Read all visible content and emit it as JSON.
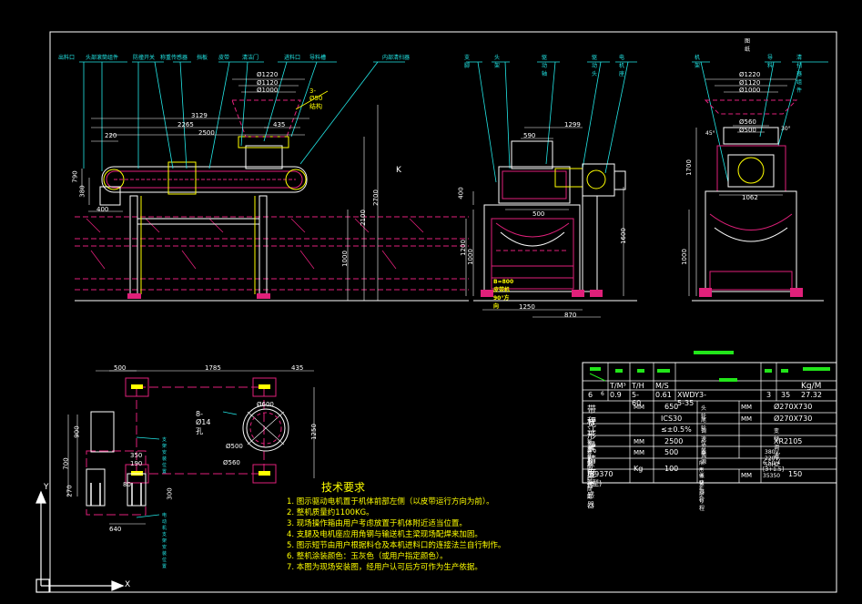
{
  "front_view": {
    "callouts": [
      "出料口",
      "头部滚筒组件",
      "防撞开关",
      "称重传感器",
      "挡板",
      "皮带",
      "清洁门",
      "进料口",
      "导料槽",
      "内部清扫器"
    ],
    "dims": {
      "d1220": "Ø1220",
      "d1120": "Ø1120",
      "d1000": "Ø1000",
      "d3129": "3129",
      "d2265": "2265",
      "d435": "435",
      "d2500": "2500",
      "d220": "220",
      "d790": "790",
      "d380": "380",
      "d400": "400",
      "d2700": "2700",
      "d2100": "2100",
      "d1000v": "1000",
      "d500note": "3-Ø50 结构"
    },
    "k_label": "K"
  },
  "side_view": {
    "callouts": [
      "支脚",
      "头架",
      "驱动轴",
      "驱动头",
      "电机座"
    ],
    "dims": {
      "d1299": "1299",
      "d590": "590",
      "d500": "500",
      "d400": "400",
      "d1200": "1200",
      "d1000": "1000",
      "d1600": "1600",
      "d1250": "1250",
      "d870": "870"
    },
    "belt_label": "B=800皮带机90°方向"
  },
  "end_view": {
    "top_label": "图纸",
    "callouts": [
      "机架",
      "导料",
      "清扫器组件"
    ],
    "dims": {
      "d1220": "Ø1220",
      "d1120": "Ø1120",
      "d1000": "Ø1000",
      "d560": "Ø560",
      "d500": "Ø500",
      "d1700": "1700",
      "d1062": "1062",
      "d1000v": "1000",
      "a45": "45°",
      "a30": "30°"
    }
  },
  "plan_view": {
    "dims": {
      "d500": "500",
      "d1785": "1785",
      "d435": "435",
      "d600": "Ø600",
      "d14": "8-Ø14孔",
      "d500c": "Ø500",
      "d560": "Ø560",
      "d1250": "1250",
      "d640": "640",
      "d300": "300",
      "d80": "80",
      "d190": "190",
      "d350": "350",
      "d900": "900",
      "d700": "700",
      "d270": "270"
    },
    "notes": [
      "支架安装位置",
      "电动机支架安装位置"
    ]
  },
  "tech": {
    "title": "技术要求",
    "items": [
      "1. 图示驱动电机置于机体前部左侧（以皮带运行方向为前）。",
      "2. 整机质量约1100KG。",
      "3. 现场操作箱由用户考虑放置于机体附近适当位置。",
      "4. 支腿及电机座应用角钢与输送机主梁现场配焊来加固。",
      "5. 图示短节由用户根据料仓及本机进料口的连接法兰自行制作。",
      "6. 整机涂装颜色：玉灰色（或用户指定颜色）。",
      "7. 本图为现场安装图，经用户认可后方可作为生产依据。"
    ]
  },
  "spec_table": {
    "units": {
      "tm": "T/M³",
      "th": "T/H",
      "ms": "M/S",
      "kgm": "Kg/M"
    },
    "row1": {
      "n6": "6",
      "n6b": "6",
      "ms_val": "0.9",
      "th_val": "5-60",
      "sp": "0.61",
      "model": "XWDY3-5-35",
      "n3": "3",
      "n35": "35",
      "kg": "27.32"
    },
    "rows": [
      {
        "l": "带宽",
        "u": "MM",
        "v": "650",
        "l2": "头轮",
        "u2": "MM",
        "v2": "Ø270X730"
      },
      {
        "l": "秤形式",
        "u": "",
        "v": "ICS30",
        "l2": "尾轮",
        "u2": "MM",
        "v2": "Ø270X730"
      },
      {
        "l": "计量精度",
        "u": "",
        "v": "≤±0.5%",
        "l2": "调速方式",
        "u2": "",
        "v2": "变频调速"
      },
      {
        "l": "称重托辊中心距",
        "u": "MM",
        "v": "2500",
        "l2": "仪表",
        "u2": "",
        "v2": "XR2105"
      },
      {
        "l": "称重区托辊间距",
        "u": "MM",
        "v": "500",
        "l2": "电源",
        "u2": "",
        "v2": "380V, 220V, 50HZ"
      },
      {
        "l": "称重传感器",
        "u": "Kg",
        "v": "100",
        "l2": "所用电动机型号",
        "u2": "",
        "v2": "6.50/4 [3+1.5] 35350"
      },
      {
        "l": "(9370型)",
        "u": "",
        "v": "",
        "l2": "张紧器行程",
        "u2": "MM",
        "v2": "150"
      }
    ]
  },
  "ucs": {
    "x": "X",
    "y": "Y"
  }
}
